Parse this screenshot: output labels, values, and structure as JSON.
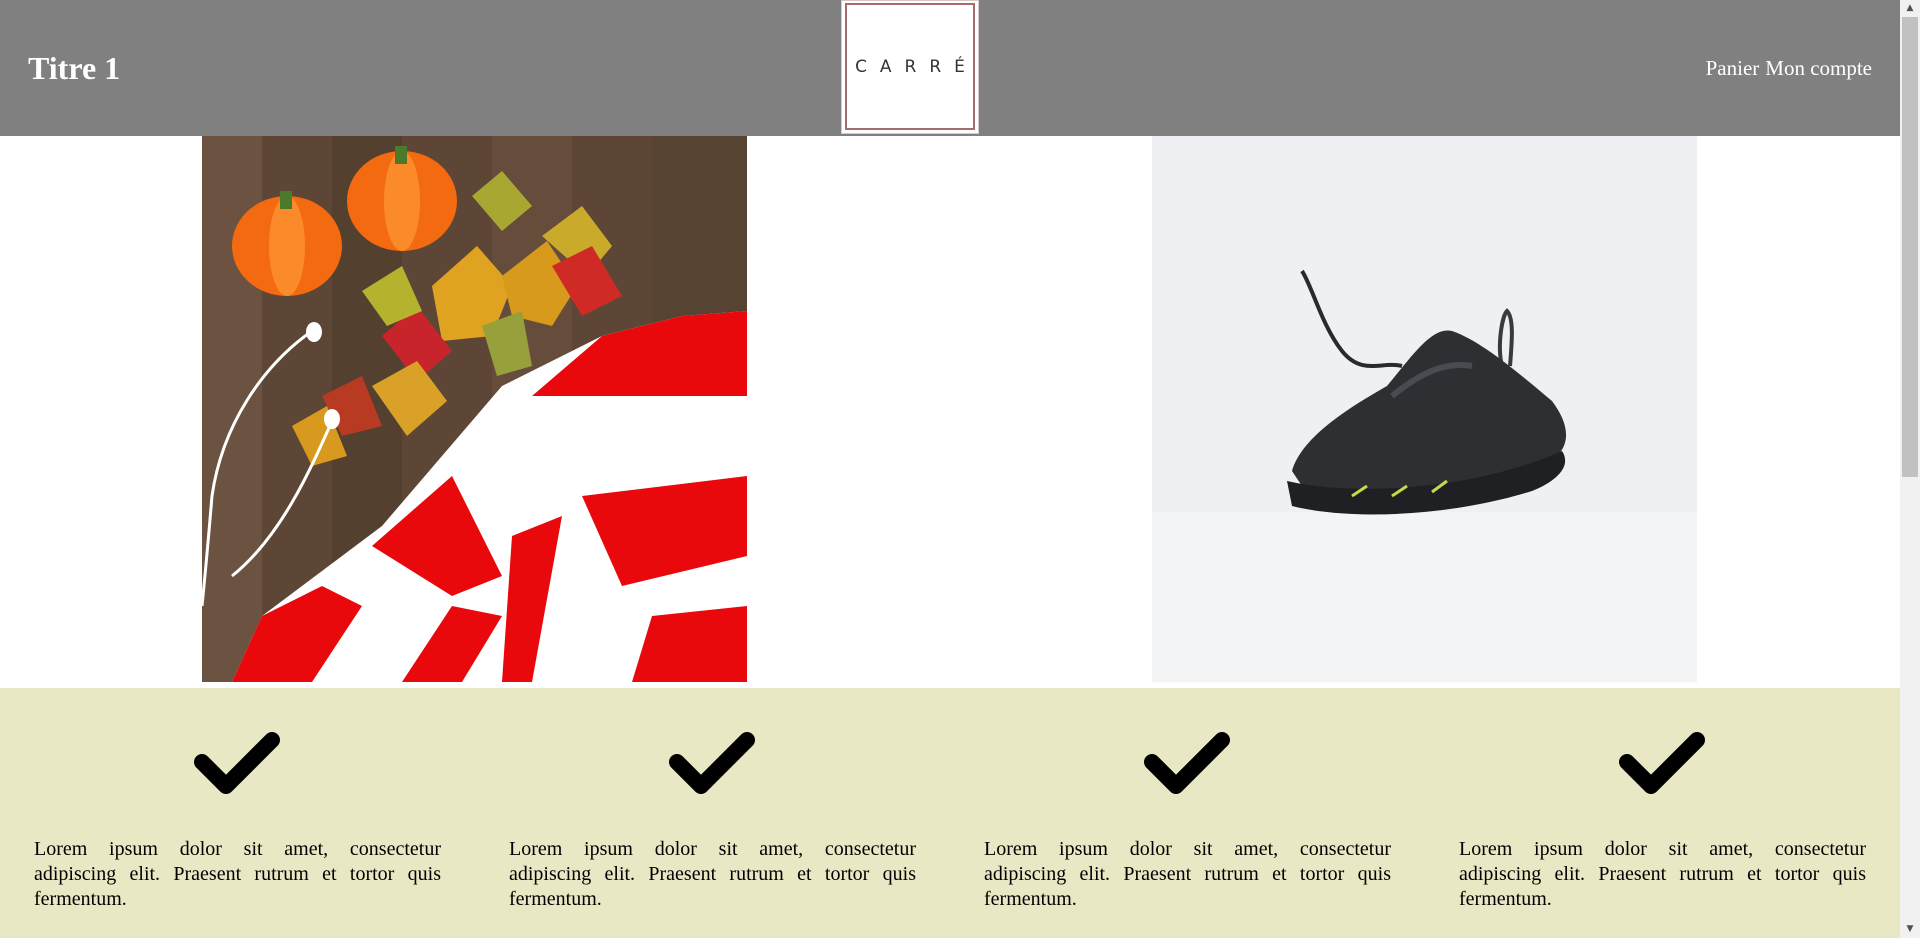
{
  "header": {
    "title": "Titre 1",
    "logo_text": "CARRÉ",
    "nav": [
      {
        "label": "Panier"
      },
      {
        "label": "Mon compte"
      }
    ]
  },
  "hero": {
    "images": [
      {
        "name": "autumn-sweater-photo"
      },
      {
        "name": "black-sneaker-photo"
      }
    ]
  },
  "features": [
    {
      "icon": "check-icon",
      "text": "Lorem ipsum dolor sit amet, consectetur adipiscing elit. Praesent rutrum et tortor quis fermentum."
    },
    {
      "icon": "check-icon",
      "text": "Lorem ipsum dolor sit amet, consectetur adipiscing elit. Praesent rutrum et tortor quis fermentum."
    },
    {
      "icon": "check-icon",
      "text": "Lorem ipsum dolor sit amet, consectetur adipiscing elit. Praesent rutrum et tortor quis fermentum."
    },
    {
      "icon": "check-icon",
      "text": "Lorem ipsum dolor sit amet, consectetur adipiscing elit. Praesent rutrum et tortor quis fermentum."
    }
  ],
  "colors": {
    "header_bg": "#808080",
    "features_bg": "#e8e8c4",
    "logo_border": "#a76b6b"
  }
}
